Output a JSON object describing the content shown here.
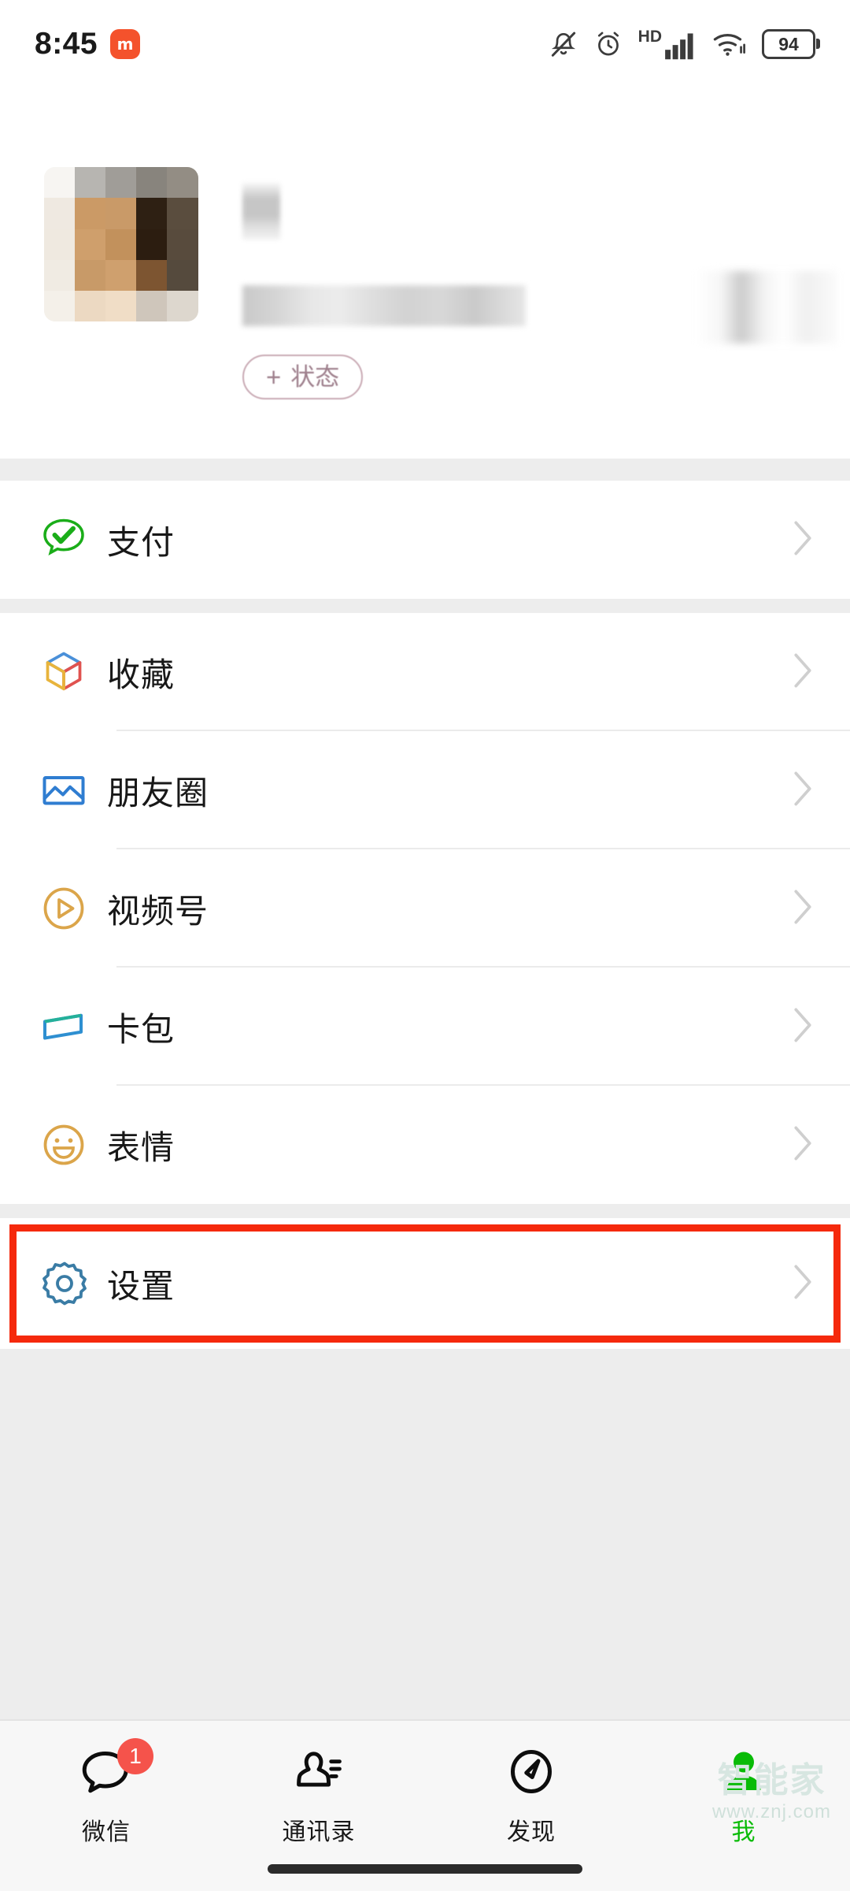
{
  "status_bar": {
    "time": "8:45",
    "brand_logo": "mi",
    "icons": [
      "bell-mute-icon",
      "alarm-clock-icon",
      "hd-icon",
      "signal-bars-icon",
      "wifi-icon",
      "battery-icon"
    ],
    "hd_label": "HD",
    "battery_level": "94"
  },
  "profile": {
    "avatar": "pixelated-avatar-censored",
    "name": "",
    "wechat_id": "",
    "qr_icon": "qr-code-icon",
    "status_button": {
      "plus": "+",
      "label": "状态"
    }
  },
  "menu": {
    "groups": [
      {
        "items": [
          {
            "label": "支付",
            "icon": "pay-icon",
            "color": "#1aad19"
          }
        ]
      },
      {
        "items": [
          {
            "label": "收藏",
            "icon": "favorites-cube-icon",
            "color": "#4a90d9"
          },
          {
            "label": "朋友圈",
            "icon": "moments-photo-icon",
            "color": "#2f7dd1"
          },
          {
            "label": "视频号",
            "icon": "channels-play-icon",
            "color": "#dba54a"
          },
          {
            "label": "卡包",
            "icon": "cards-wallet-icon",
            "color": "#2e8fd1"
          },
          {
            "label": "表情",
            "icon": "stickers-smiley-icon",
            "color": "#dba54a"
          }
        ]
      },
      {
        "items": [
          {
            "label": "设置",
            "icon": "settings-gear-icon",
            "color": "#3a7ca5"
          }
        ]
      }
    ]
  },
  "annotation": {
    "highlight_color": "#f5290c",
    "target": "设置"
  },
  "tabbar": {
    "tabs": [
      {
        "label": "微信",
        "icon": "chat-bubble-icon",
        "badge": "1",
        "active": false
      },
      {
        "label": "通讯录",
        "icon": "contacts-icon",
        "badge": "",
        "active": false
      },
      {
        "label": "发现",
        "icon": "discover-compass-icon",
        "badge": "",
        "active": false
      },
      {
        "label": "我",
        "icon": "me-person-icon",
        "badge": "",
        "active": true
      }
    ],
    "active_color": "#09bb07"
  },
  "watermark": {
    "line1": "智能家",
    "line2": "www.znj.com"
  }
}
